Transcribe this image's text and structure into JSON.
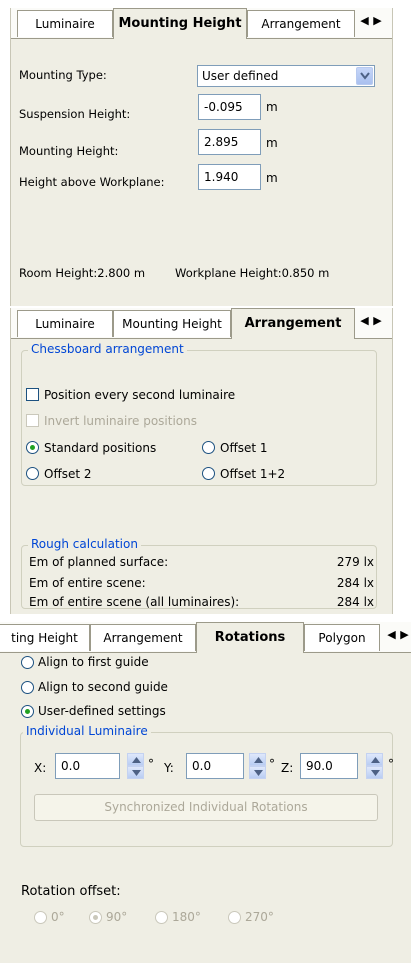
{
  "panel_mounting": {
    "tabs": [
      "Luminaire",
      "Mounting Height",
      "Arrangement"
    ],
    "active_tab": "Mounting Height",
    "mounting_type_label": "Mounting Type:",
    "mounting_type_value": "User defined",
    "suspension_label": "Suspension Height:",
    "suspension_value": "-0.095",
    "suspension_unit": "m",
    "mounting_height_label": "Mounting Height:",
    "mounting_height_value": "2.895",
    "mounting_height_unit": "m",
    "workplane_label": "Height above Workplane:",
    "workplane_value": "1.940",
    "workplane_unit": "m",
    "room_height": "Room Height:2.800 m",
    "workplane_height": "Workplane Height:0.850 m"
  },
  "panel_arrangement": {
    "tabs": [
      "Luminaire",
      "Mounting Height",
      "Arrangement"
    ],
    "active_tab": "Arrangement",
    "chessboard_legend": "Chessboard arrangement",
    "position_every_second": "Position every second luminaire",
    "position_every_second_checked": false,
    "invert_positions": "Invert luminaire positions",
    "invert_positions_enabled": false,
    "standard_positions": "Standard positions",
    "offset1": "Offset 1",
    "offset2": "Offset 2",
    "offset12": "Offset 1+2",
    "selected_position": "Standard positions",
    "rough_legend": "Rough calculation",
    "rows": [
      {
        "label": "Em of planned surface:",
        "value": "279 lx"
      },
      {
        "label": "Em of entire scene:",
        "value": "284 lx"
      },
      {
        "label": "Em of entire scene (all luminaires):",
        "value": "284 lx"
      }
    ]
  },
  "panel_rotations": {
    "tabs": [
      "ting Height",
      "Arrangement",
      "Rotations",
      "Polygon"
    ],
    "active_tab": "Rotations",
    "align_first": "Align to first guide",
    "align_second": "Align to second guide",
    "user_defined": "User-defined settings",
    "selected_alignment": "User-defined settings",
    "individual_legend": "Individual Luminaire",
    "x_label": "X:",
    "x_value": "0.0",
    "y_label": "Y:",
    "y_value": "0.0",
    "z_label": "Z:",
    "z_value": "90.0",
    "degree": "°",
    "sync_button": "Synchronized Individual Rotations",
    "rotation_offset_label": "Rotation offset:",
    "offsets": [
      "0°",
      "90°",
      "180°",
      "270°"
    ],
    "selected_offset": "90°"
  },
  "colors": {
    "panel_bg": "#efeee4",
    "group_legend": "#0046d5",
    "radio_dot": "#21a121",
    "field_border": "#7f9db9"
  }
}
